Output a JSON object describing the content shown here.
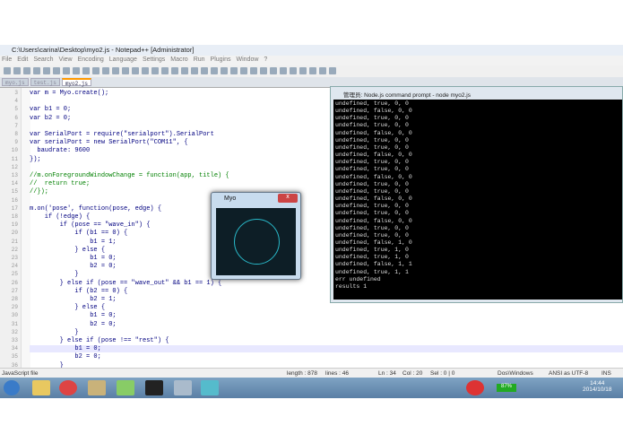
{
  "window": {
    "title": "C:\\Users\\carina\\Desktop\\myo2.js - Notepad++ [Administrator]"
  },
  "menu": [
    "File",
    "Edit",
    "Search",
    "View",
    "Encoding",
    "Language",
    "Settings",
    "Macro",
    "Run",
    "Plugins",
    "Window",
    "?"
  ],
  "tabs": [
    {
      "label": "myo.js"
    },
    {
      "label": "test.js"
    },
    {
      "label": "myo2.js",
      "active": true
    }
  ],
  "code": [
    {
      "n": "3",
      "t": "var m = Myo.create();"
    },
    {
      "n": "4",
      "t": ""
    },
    {
      "n": "5",
      "t": "var b1 = 0;"
    },
    {
      "n": "6",
      "t": "var b2 = 0;"
    },
    {
      "n": "7",
      "t": ""
    },
    {
      "n": "8",
      "t": "var SerialPort = require(\"serialport\").SerialPort"
    },
    {
      "n": "9",
      "t": "var serialPort = new SerialPort(\"COM11\", {"
    },
    {
      "n": "10",
      "t": "  baudrate: 9600"
    },
    {
      "n": "11",
      "t": "});"
    },
    {
      "n": "12",
      "t": ""
    },
    {
      "n": "13",
      "t": "//m.onForegroundWindowChange = function(app, title) {"
    },
    {
      "n": "14",
      "t": "//  return true;"
    },
    {
      "n": "15",
      "t": "//});"
    },
    {
      "n": "16",
      "t": ""
    },
    {
      "n": "17",
      "t": "m.on('pose', function(pose, edge) {"
    },
    {
      "n": "18",
      "t": "    if (!edge) {"
    },
    {
      "n": "19",
      "t": "        if (pose == \"wave_in\") {"
    },
    {
      "n": "20",
      "t": "            if (b1 == 0) {"
    },
    {
      "n": "21",
      "t": "                b1 = 1;"
    },
    {
      "n": "22",
      "t": "            } else {"
    },
    {
      "n": "23",
      "t": "                b1 = 0;"
    },
    {
      "n": "24",
      "t": "                b2 = 0;"
    },
    {
      "n": "25",
      "t": "            }"
    },
    {
      "n": "26",
      "t": "        } else if (pose == \"wave_out\" && b1 == 1) {"
    },
    {
      "n": "27",
      "t": "            if (b2 == 0) {"
    },
    {
      "n": "28",
      "t": "                b2 = 1;"
    },
    {
      "n": "29",
      "t": "            } else {"
    },
    {
      "n": "30",
      "t": "                b1 = 0;"
    },
    {
      "n": "31",
      "t": "                b2 = 0;"
    },
    {
      "n": "32",
      "t": "            }"
    },
    {
      "n": "33",
      "t": "        } else if (pose !== \"rest\") {"
    },
    {
      "n": "34",
      "t": "            b1 = 0;"
    },
    {
      "n": "35",
      "t": "            b2 = 0;"
    },
    {
      "n": "36",
      "t": "        }"
    }
  ],
  "status": {
    "type": "JavaScript file",
    "length": "length : 878",
    "lines": "lines : 46",
    "ln": "Ln : 34",
    "col": "Col : 20",
    "sel": "Sel : 0 | 0",
    "eol": "Dos\\Windows",
    "enc": "ANSI as UTF-8",
    "mode": "INS"
  },
  "terminal": {
    "title": "管理员: Node.js command prompt - node  myo2.js",
    "output": "undefined, true, 0, 0\nundefined, false, 0, 0\nundefined, true, 0, 0\nundefined, true, 0, 0\nundefined, false, 0, 0\nundefined, true, 0, 0\nundefined, true, 0, 0\nundefined, false, 0, 0\nundefined, true, 0, 0\nundefined, true, 0, 0\nundefined, false, 0, 0\nundefined, true, 0, 0\nundefined, true, 0, 0\nundefined, false, 0, 0\nundefined, true, 0, 0\nundefined, true, 0, 0\nundefined, false, 0, 0\nundefined, true, 0, 0\nundefined, true, 0, 0\nundefined, false, 1, 0\nundefined, true, 1, 0\nundefined, true, 1, 0\nundefined, false, 1, 1\nundefined, true, 1, 1\nerr undefined\nresults 1"
  },
  "myo": {
    "title": "Myo",
    "close": "x"
  },
  "taskbar": {
    "battery": "87%",
    "time": "14:44",
    "date": "2014/10/18"
  }
}
